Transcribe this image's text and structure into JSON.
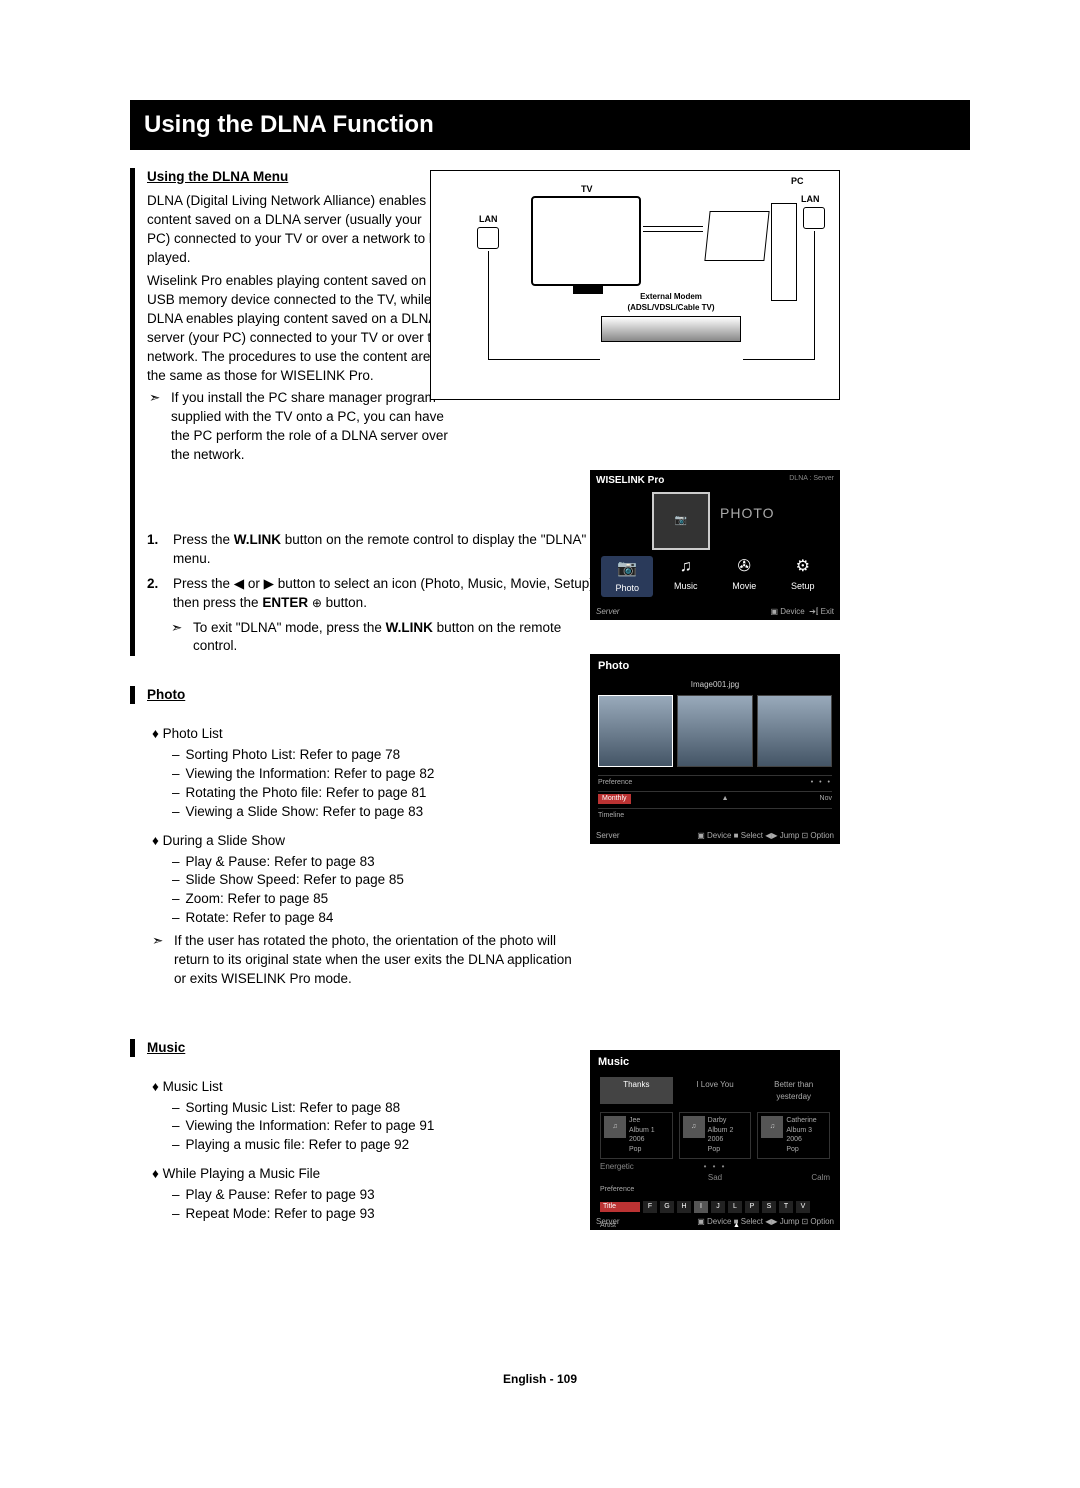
{
  "title": "Using the DLNA Function",
  "section1": {
    "heading": "Using the DLNA Menu",
    "p1": "DLNA (Digital Living Network Alliance) enables content saved on a DLNA server (usually your PC) connected to your TV or over a network to be played.",
    "p2": "Wiselink Pro enables playing content saved on a USB memory device connected to the TV, while DLNA enables playing content saved on a DLNA server (your PC) connected to your TV or over the network. The procedures to use the content are the same as those for WISELINK Pro.",
    "note1": "If you install the PC share manager program supplied with the TV onto a PC, you can have the PC perform the role of a DLNA server over the network."
  },
  "diagram": {
    "tv": "TV",
    "pc": "PC",
    "lan": "LAN",
    "modem1": "External Modem",
    "modem2": "(ADSL/VDSL/Cable TV)"
  },
  "steps": {
    "s1_pre": "Press the ",
    "s1_bold": "W.LINK",
    "s1_post": " button on the remote control to display the \"DLNA\" menu.",
    "s2_a": "Press the ◀ or ▶ button to select an icon (Photo, Music, Movie, Setup), then press the ",
    "s2_enter": "ENTER",
    "s2_b": " button.",
    "s2_note_pre": "To exit \"DLNA\" mode, press the ",
    "s2_note_bold": "W.LINK",
    "s2_note_post": " button on the remote control."
  },
  "photo": {
    "heading": "Photo",
    "list_head": "Photo List",
    "l1": "Sorting Photo List: Refer to page 78",
    "l2": "Viewing the Information: Refer to page 82",
    "l3": "Rotating the Photo file: Refer to page 81",
    "l4": "Viewing a Slide Show: Refer to page 83",
    "slide_head": "During a Slide Show",
    "s1": "Play & Pause: Refer to page 83",
    "s2": "Slide Show Speed: Refer to page 85",
    "s3": "Zoom: Refer to page 85",
    "s4": "Rotate: Refer to page 84",
    "note": "If the user has rotated the photo, the orientation of the photo will return to its original state when the user exits the DLNA application or exits WISELINK Pro mode."
  },
  "music": {
    "heading": "Music",
    "list_head": "Music List",
    "l1": "Sorting Music List: Refer to page 88",
    "l2": "Viewing the Information: Refer to page 91",
    "l3": "Playing a music file: Refer to page 92",
    "play_head": "While Playing a Music File",
    "p1": "Play & Pause: Refer to page 93",
    "p2": "Repeat Mode: Refer to page 93"
  },
  "shot1": {
    "title": "WISELINK Pro",
    "src": "DLNA : Server",
    "big": "PHOTO",
    "items": [
      "Photo",
      "Music",
      "Movie",
      "Setup"
    ],
    "server": "Server",
    "device": "▣ Device",
    "exit": "➔⫿ Exit"
  },
  "shot2": {
    "title": "Photo",
    "fname": "Image001.jpg",
    "pref": "Preference",
    "monthly": "Monthly",
    "timeline": "Timeline",
    "nov": "Nov",
    "server": "Server",
    "foot": "▣ Device   ■ Select   ◀▶ Jump   ⊡ Option"
  },
  "shot3": {
    "title": "Music",
    "tabs": [
      "Thanks",
      "I Love You",
      "Better than yesterday"
    ],
    "albums": [
      {
        "artist": "Jee",
        "name": "Album 1",
        "year": "2006",
        "genre": "Pop"
      },
      {
        "artist": "Darby",
        "name": "Album 2",
        "year": "2006",
        "genre": "Pop"
      },
      {
        "artist": "Catherine",
        "name": "Album 3",
        "year": "2006",
        "genre": "Pop"
      }
    ],
    "moods": [
      "Energetic",
      "Sad",
      "Calm"
    ],
    "pref": "Preference",
    "title_row": "Title",
    "artist_row": "Artist",
    "letters": [
      "F",
      "G",
      "H",
      "I",
      "J",
      "L",
      "P",
      "S",
      "T",
      "V"
    ],
    "server": "Server",
    "foot": "▣ Device   ■ Select   ◀▶ Jump   ⊡ Option"
  },
  "footer": "English - 109"
}
